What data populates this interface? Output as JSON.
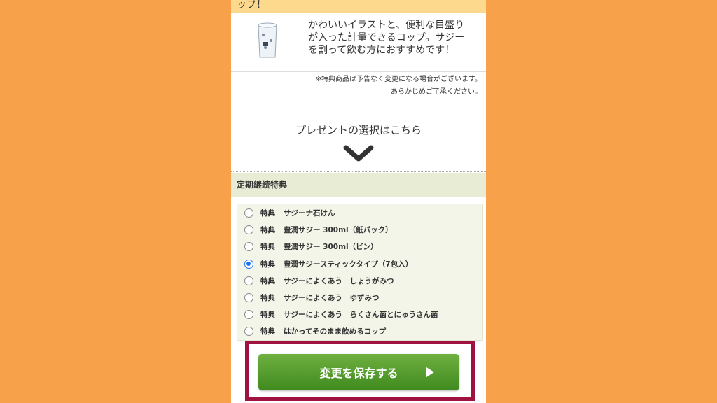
{
  "banner": {
    "text": "ップ！"
  },
  "product": {
    "image_icon": "cup-icon",
    "desc_line1": "かわいいイラストと、便利な目盛り",
    "desc_line2": "が入った計量できるコップ。サジー",
    "desc_line3": "を割って飲む方におすすめです！"
  },
  "notice": {
    "line1": "※特典商品は予告なく変更になる場合がございます。",
    "line2": "あらかじめご了承ください。"
  },
  "present": {
    "label": "プレゼントの選択はこちら",
    "icon": "chevron-down-icon"
  },
  "section": {
    "title": "定期継続特典"
  },
  "options": [
    {
      "badge": "特典",
      "label": "サジーナ石けん",
      "checked": false
    },
    {
      "badge": "特典",
      "label": "豊潤サジー 300ml（紙パック）",
      "checked": false
    },
    {
      "badge": "特典",
      "label": "豊潤サジー 300ml（ビン）",
      "checked": false
    },
    {
      "badge": "特典",
      "label": "豊潤サジースティックタイプ（7包入）",
      "checked": true
    },
    {
      "badge": "特典",
      "label": "サジーによくあう　しょうがみつ",
      "checked": false
    },
    {
      "badge": "特典",
      "label": "サジーによくあう　ゆずみつ",
      "checked": false
    },
    {
      "badge": "特典",
      "label": "サジーによくあう　らくさん菌とにゅうさん菌",
      "checked": false
    },
    {
      "badge": "特典",
      "label": "はかってそのまま飲めるコップ",
      "checked": false
    }
  ],
  "save": {
    "label": "変更を保存する",
    "icon": "play-arrow-icon"
  },
  "colors": {
    "page_bg": "#F7A24A",
    "banner_bg": "#FCD98C",
    "section_bg": "#E8ECD4",
    "button_green": "#4E9A2A",
    "highlight": "#A0123F",
    "radio_selected": "#1A73E8"
  }
}
